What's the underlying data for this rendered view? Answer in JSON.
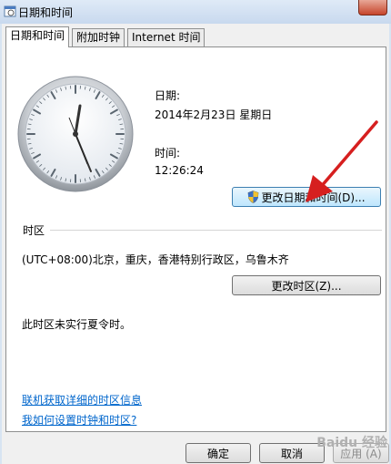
{
  "window": {
    "title": "日期和时间"
  },
  "tabs": [
    {
      "label": "日期和时间",
      "active": true
    },
    {
      "label": "附加时钟",
      "active": false
    },
    {
      "label": "Internet 时间",
      "active": false
    }
  ],
  "date_time": {
    "date_label": "日期:",
    "date_value": "2014年2月23日 星期日",
    "time_label": "时间:",
    "time_value": "12:26:24",
    "change_datetime_button": "更改日期和时间(D)..."
  },
  "timezone": {
    "section_label": "时区",
    "value": "(UTC+08:00)北京，重庆，香港特别行政区，乌鲁木齐",
    "change_timezone_button": "更改时区(Z)...",
    "dst_note": "此时区未实行夏令时。"
  },
  "links": {
    "online_info": "联机获取详细的时区信息",
    "how_to": "我如何设置时钟和时区?"
  },
  "footer": {
    "ok": "确定",
    "cancel": "取消",
    "apply": "应用 (A)"
  },
  "watermark": "Baidu 经验",
  "icons": {
    "title": "clock-calendar-icon",
    "shield": "uac-shield-icon",
    "annotation": "red-arrow"
  },
  "colors": {
    "link": "#0066cc",
    "arrow": "#d61f1f",
    "focus_border": "#3c7fb1"
  }
}
